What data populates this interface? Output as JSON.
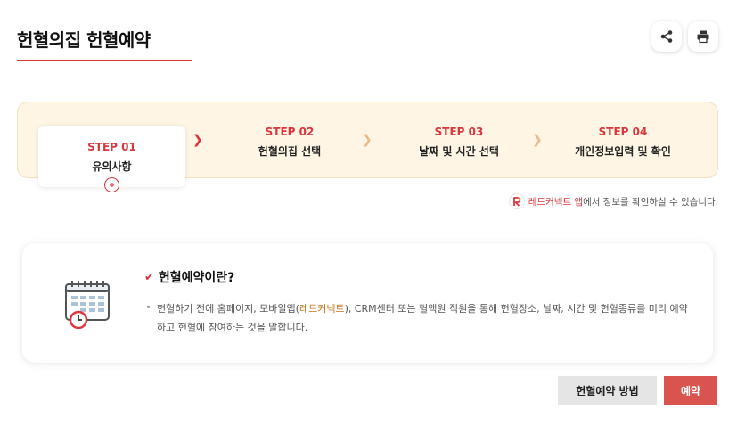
{
  "header": {
    "title": "헌혈의집 헌혈예약",
    "share_icon": "share-icon",
    "print_icon": "print-icon"
  },
  "steps": [
    {
      "number": "STEP 01",
      "label": "유의사항",
      "active": true
    },
    {
      "number": "STEP 02",
      "label": "헌혈의집 선택",
      "active": false
    },
    {
      "number": "STEP 03",
      "label": "날짜 및 시간 선택",
      "active": false
    },
    {
      "number": "STEP 04",
      "label": "개인정보입력 및 확인",
      "active": false
    }
  ],
  "app_note": {
    "app_name": "레드커넥트 앱",
    "text": "에서 정보를 확인하실 수 있습니다."
  },
  "info": {
    "title": "헌혈예약이란?",
    "desc_part1": "헌혈하기 전에 홈페이지, 모바일앱(",
    "desc_highlight": "레드커넥트",
    "desc_part2": "), CRM센터 또는 혈액원 직원을 통해 헌혈장소, 날짜, 시간 및 헌혈종류를 미리 예약하고 헌혈에 참여하는 것을 말합니다."
  },
  "buttons": {
    "method": "헌혈예약 방법",
    "reserve": "예약"
  },
  "colors": {
    "accent": "#d9363e",
    "steps_bg": "#fef5e4",
    "reserve_bg": "#d9534f",
    "method_bg": "#e5e5e5",
    "highlight": "#c0741a"
  }
}
